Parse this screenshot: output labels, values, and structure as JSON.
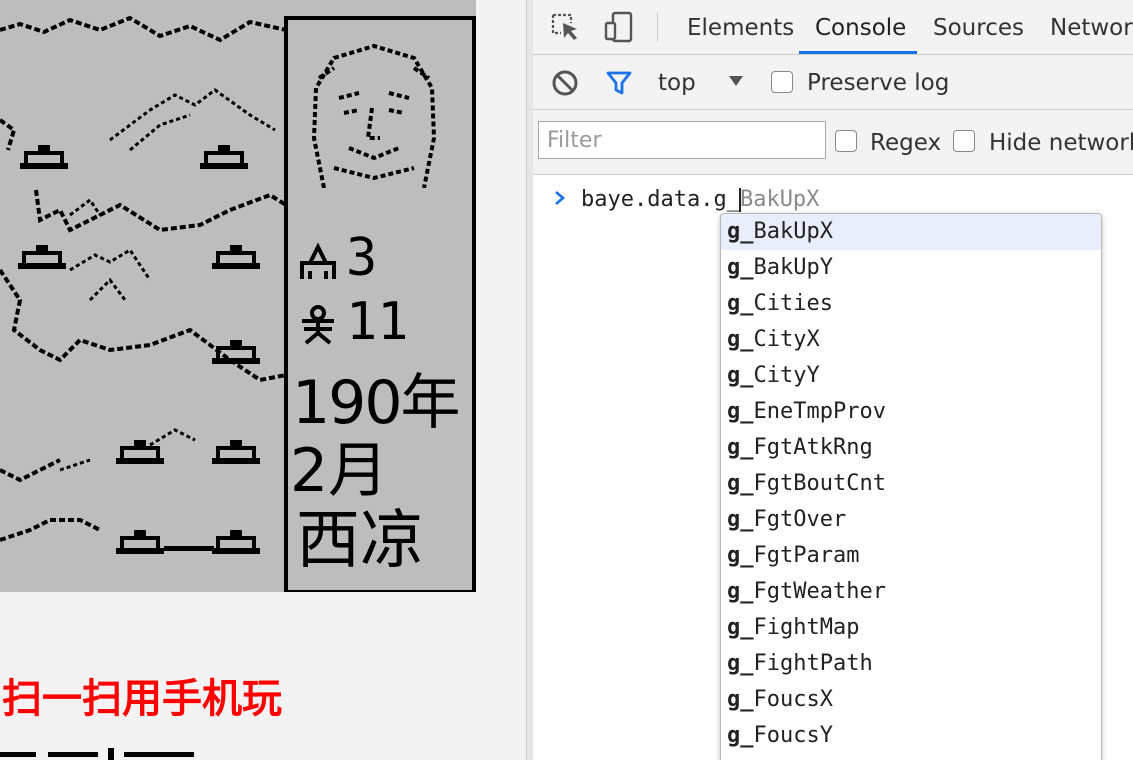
{
  "game": {
    "soldiers": "3",
    "generals": "11",
    "year": "190年",
    "month": "2月",
    "city": "西凉",
    "scan_prompt": "扫一扫用手机玩"
  },
  "devtools": {
    "tabs": [
      "Elements",
      "Console",
      "Sources",
      "Network"
    ],
    "active_tab": "Console",
    "context": "top",
    "preserve_log_label": "Preserve log",
    "filter_placeholder": "Filter",
    "regex_label": "Regex",
    "hide_network_label": "Hide network",
    "console_input": "baye.data.g_",
    "ghost_completion": "BakUpX",
    "autocomplete_prefix": "g_",
    "autocomplete_items": [
      "BakUpX",
      "BakUpY",
      "Cities",
      "CityX",
      "CityY",
      "EneTmpProv",
      "FgtAtkRng",
      "FgtBoutCnt",
      "FgtOver",
      "FgtParam",
      "FgtWeather",
      "FightMap",
      "FightPath",
      "FoucsX",
      "FoucsY"
    ],
    "selected_index": 0,
    "accent_color": "#1a73e8"
  }
}
